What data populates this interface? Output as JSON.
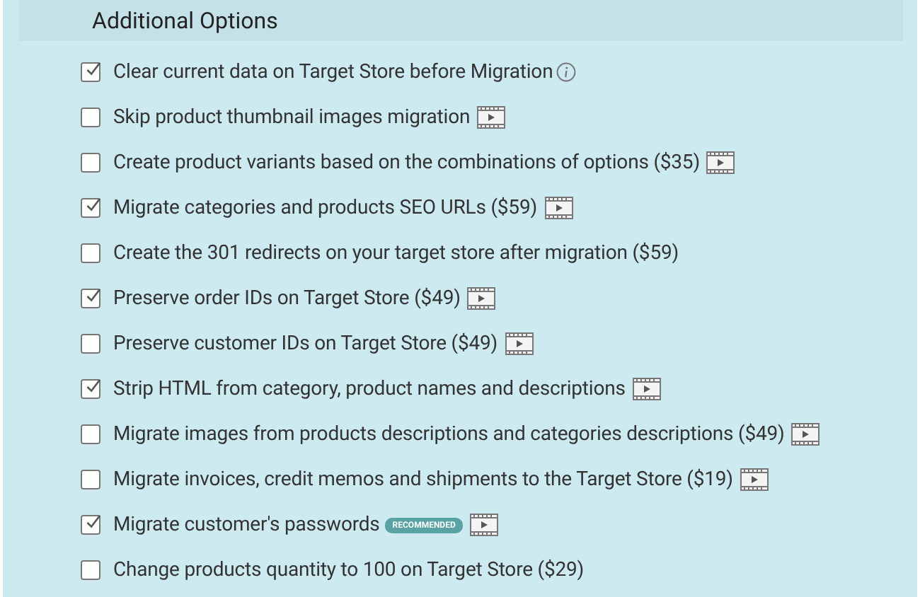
{
  "section": {
    "title": "Additional Options"
  },
  "options": [
    {
      "kind": "note",
      "label": "Clear current data on Target Store before Migration",
      "checked": true
    },
    {
      "kind": "demo",
      "label": "Skip product thumbnail images migration",
      "checked": false
    },
    {
      "kind": "demo",
      "label": "Create product variants based on the combinations of options ($35)",
      "checked": false
    },
    {
      "kind": "demo",
      "label": "Migrate categories and products SEO URLs ($59)",
      "checked": true
    },
    {
      "kind": "plain",
      "label": "Create the 301 redirects on your target store after migration ($59)",
      "checked": false
    },
    {
      "kind": "demo",
      "label": "Preserve order IDs on Target Store ($49)",
      "checked": true
    },
    {
      "kind": "demo",
      "label": "Preserve customer IDs on Target Store ($49)",
      "checked": false
    },
    {
      "kind": "demo",
      "label": "Strip HTML from category, product names and descriptions",
      "checked": true
    },
    {
      "kind": "demo",
      "label": "Migrate images from products descriptions and categories descriptions ($49)",
      "checked": false
    },
    {
      "kind": "demo",
      "label": "Migrate invoices, credit memos and shipments to the Target Store ($19)",
      "checked": false
    },
    {
      "kind": "demo",
      "label": "Migrate customer's passwords",
      "checked": true,
      "badge": "RECOMMENDED"
    },
    {
      "kind": "plain",
      "label": "Change products quantity to 100 on Target Store ($29)",
      "checked": false
    }
  ]
}
